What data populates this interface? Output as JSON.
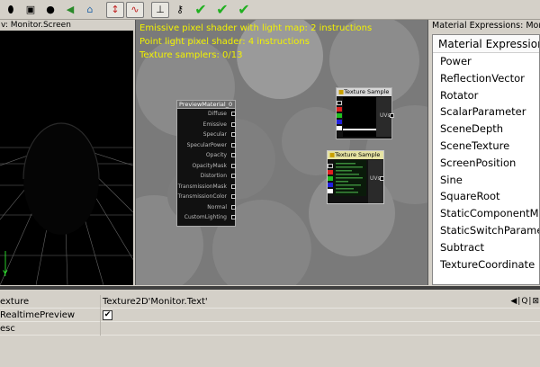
{
  "toolbar": {
    "buttons": [
      {
        "name": "cylinder-preview-icon",
        "glyph": "⬮"
      },
      {
        "name": "cube-preview-icon",
        "glyph": "▣"
      },
      {
        "name": "sphere-preview-icon",
        "glyph": "●"
      },
      {
        "name": "back-arrow-icon",
        "glyph": "◀"
      },
      {
        "name": "home-icon",
        "glyph": "⌂"
      },
      {
        "name": "toggle-realtime-icon",
        "glyph": "↕"
      },
      {
        "name": "curve-icon",
        "glyph": "∿"
      },
      {
        "name": "stats-icon",
        "glyph": "⊥"
      },
      {
        "name": "key-icon",
        "glyph": "⚷"
      },
      {
        "name": "apply-icon",
        "glyph": "✔"
      },
      {
        "name": "apply-icon",
        "glyph": "✔"
      },
      {
        "name": "apply-icon",
        "glyph": "✔"
      }
    ]
  },
  "viewport": {
    "title": "v: Monitor.Screen",
    "axis_label": "Y"
  },
  "editor": {
    "stats": [
      "Emissive pixel shader with light map: 2 instructions",
      "Point light pixel shader: 4 instructions",
      "Texture samplers: 0/13"
    ],
    "preview_node": {
      "title": "PreviewMaterial_0",
      "inputs": [
        "Diffuse",
        "Emissive",
        "Specular",
        "SpecularPower",
        "Opacity",
        "OpacityMask",
        "Distortion",
        "TransmissionMask",
        "TransmissionColor",
        "Normal",
        "CustomLighting"
      ]
    },
    "texture_nodes": [
      {
        "title": "Texture Sample",
        "output": "UVs"
      },
      {
        "title": "Texture Sample",
        "output": "UVs"
      }
    ]
  },
  "expressions": {
    "panel_title": "Material Expressions: Mon",
    "header": "Material Expressions",
    "items": [
      "Power",
      "ReflectionVector",
      "Rotator",
      "ScalarParameter",
      "SceneDepth",
      "SceneTexture",
      "ScreenPosition",
      "Sine",
      "SquareRoot",
      "StaticComponentMask",
      "StaticSwitchParameter",
      "Subtract",
      "TextureCoordinate"
    ]
  },
  "properties": {
    "rows": [
      {
        "name": "exture",
        "value": "Texture2D'Monitor.Text'",
        "buttons": "◀|Q|⊠"
      },
      {
        "name": "RealtimePreview",
        "value": "",
        "checked": "✔"
      },
      {
        "name": "esc",
        "value": ""
      }
    ]
  },
  "colors": {
    "stats_text": "#f2f200",
    "canvas_bg": "#7a7a7a",
    "viewport_bg": "#000000",
    "check_green": "#20b020"
  }
}
